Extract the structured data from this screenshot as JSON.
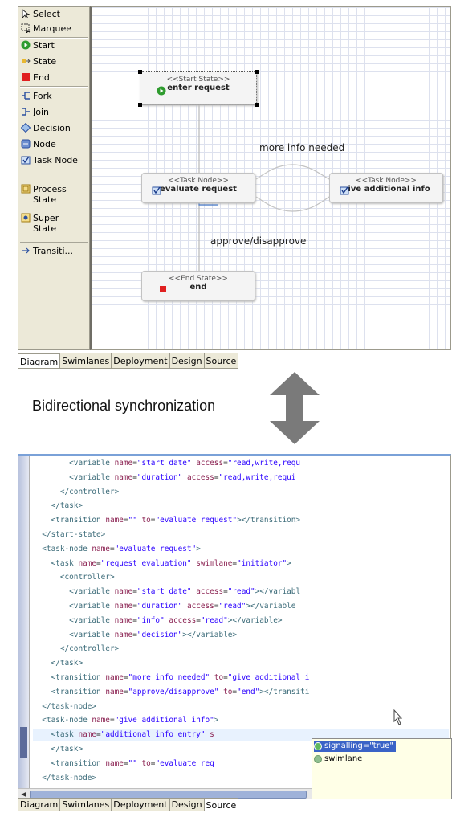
{
  "palette": {
    "items": [
      {
        "label": "Select",
        "icon": "select-arrow-icon"
      },
      {
        "label": "Marquee",
        "icon": "marquee-icon"
      },
      {
        "label": "Start",
        "icon": "start-state-icon"
      },
      {
        "label": "State",
        "icon": "state-icon"
      },
      {
        "label": "End",
        "icon": "end-state-icon"
      },
      {
        "label": "Fork",
        "icon": "fork-icon"
      },
      {
        "label": "Join",
        "icon": "join-icon"
      },
      {
        "label": "Decision",
        "icon": "decision-icon"
      },
      {
        "label": "Node",
        "icon": "node-icon"
      },
      {
        "label": "Task Node",
        "icon": "task-node-icon"
      },
      {
        "label": "Process State",
        "icon": "process-state-icon"
      },
      {
        "label": "Super State",
        "icon": "super-state-icon"
      },
      {
        "label": "Transiti...",
        "icon": "transition-icon"
      }
    ]
  },
  "diagram": {
    "nodes": {
      "start": {
        "stereotype": "<<Start State>>",
        "name": "enter request"
      },
      "evaluate": {
        "stereotype": "<<Task Node>>",
        "name": "evaluate request"
      },
      "give": {
        "stereotype": "<<Task Node>>",
        "name": "give additional info"
      },
      "end": {
        "stereotype": "<<End State>>",
        "name": "end"
      }
    },
    "transitions": {
      "more_info": "more info needed",
      "approve": "approve/disapprove"
    }
  },
  "tabs": [
    "Diagram",
    "Swimlanes",
    "Deployment",
    "Design",
    "Source"
  ],
  "caption": "Bidirectional synchronization",
  "source_lines": [
    [
      "t",
      "        <variable ",
      "a",
      "name",
      "p",
      "=",
      "v",
      "\"start date\"",
      "p",
      " ",
      "a",
      "access",
      "p",
      "=",
      "v",
      "\"read,write,requ"
    ],
    [
      "t",
      "        <variable ",
      "a",
      "name",
      "p",
      "=",
      "v",
      "\"duration\"",
      "p",
      " ",
      "a",
      "access",
      "p",
      "=",
      "v",
      "\"read,write,requi"
    ],
    [
      "t",
      "      </controller>"
    ],
    [
      "t",
      "    </task>"
    ],
    [
      "t",
      "    <transition ",
      "a",
      "name",
      "p",
      "=",
      "v",
      "\"\"",
      "p",
      " ",
      "a",
      "to",
      "p",
      "=",
      "v",
      "\"evaluate request\"",
      "t",
      "></transition>"
    ],
    [
      "t",
      "  </start-state>"
    ],
    [
      "t",
      "  <task-node ",
      "a",
      "name",
      "p",
      "=",
      "v",
      "\"evaluate request\"",
      "t",
      ">"
    ],
    [
      "t",
      "    <task ",
      "a",
      "name",
      "p",
      "=",
      "v",
      "\"request evaluation\"",
      "p",
      " ",
      "a",
      "swimlane",
      "p",
      "=",
      "v",
      "\"initiator\"",
      "t",
      ">"
    ],
    [
      "t",
      "      <controller>"
    ],
    [
      "t",
      "        <variable ",
      "a",
      "name",
      "p",
      "=",
      "v",
      "\"start date\"",
      "p",
      " ",
      "a",
      "access",
      "p",
      "=",
      "v",
      "\"read\"",
      "t",
      "></variabl"
    ],
    [
      "t",
      "        <variable ",
      "a",
      "name",
      "p",
      "=",
      "v",
      "\"duration\"",
      "p",
      " ",
      "a",
      "access",
      "p",
      "=",
      "v",
      "\"read\"",
      "t",
      "></variable"
    ],
    [
      "t",
      "        <variable ",
      "a",
      "name",
      "p",
      "=",
      "v",
      "\"info\"",
      "p",
      " ",
      "a",
      "access",
      "p",
      "=",
      "v",
      "\"read\"",
      "t",
      "></variable>"
    ],
    [
      "t",
      "        <variable ",
      "a",
      "name",
      "p",
      "=",
      "v",
      "\"decision\"",
      "t",
      "></variable>"
    ],
    [
      "t",
      "      </controller>"
    ],
    [
      "t",
      "    </task>"
    ],
    [
      "t",
      "    <transition ",
      "a",
      "name",
      "p",
      "=",
      "v",
      "\"more info needed\"",
      "p",
      " ",
      "a",
      "to",
      "p",
      "=",
      "v",
      "\"give additional i"
    ],
    [
      "t",
      "    <transition ",
      "a",
      "name",
      "p",
      "=",
      "v",
      "\"approve/disapprove\"",
      "p",
      " ",
      "a",
      "to",
      "p",
      "=",
      "v",
      "\"end\"",
      "t",
      "></transiti"
    ],
    [
      "t",
      "  </task-node>"
    ],
    [
      "t",
      "  <task-node ",
      "a",
      "name",
      "p",
      "=",
      "v",
      "\"give additional info\"",
      "t",
      ">"
    ],
    [
      "t",
      "    <task ",
      "a",
      "name",
      "p",
      "=",
      "v",
      "\"additional info entry\"",
      "p",
      " ",
      "a",
      "s"
    ],
    [
      "t",
      "    </task>"
    ],
    [
      "t",
      "    <transition ",
      "a",
      "name",
      "p",
      "=",
      "v",
      "\"\"",
      "p",
      " ",
      "a",
      "to",
      "p",
      "=",
      "v",
      "\"evaluate req"
    ],
    [
      "t",
      "  </task-node>"
    ]
  ],
  "content_assist": {
    "items": [
      {
        "label": "signalling=\"true\"",
        "selected": true
      },
      {
        "label": "swimlane",
        "selected": false
      }
    ]
  },
  "colors": {
    "palette_bg": "#ece9d8",
    "start_icon": "#2e9b2e",
    "end_icon": "#e02020",
    "assist_selected": "#3a63c7",
    "sync_arrow": "#7a7a7a"
  }
}
